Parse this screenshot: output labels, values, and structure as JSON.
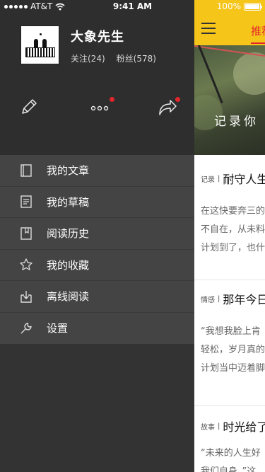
{
  "status_bar": {
    "carrier": "AT&T",
    "time": "9:41 AM",
    "battery": "100%"
  },
  "profile": {
    "username": "大象先生",
    "following": "关注(24)",
    "followers": "粉丝(578)"
  },
  "actions": {
    "edit_icon": "pencil-icon",
    "more_icon": "more-icon",
    "share_icon": "share-icon"
  },
  "menu": [
    {
      "label": "我的文章",
      "icon": "book-icon"
    },
    {
      "label": "我的草稿",
      "icon": "draft-icon"
    },
    {
      "label": "阅读历史",
      "icon": "history-icon"
    },
    {
      "label": "我的收藏",
      "icon": "star-icon"
    },
    {
      "label": "离线阅读",
      "icon": "download-box-icon"
    },
    {
      "label": "设置",
      "icon": "wrench-icon"
    }
  ],
  "main": {
    "tab_label": "推荐",
    "hero_title": "记录你",
    "articles": [
      {
        "category": "记录",
        "title": "耐守人生",
        "body": [
          "在这快要奔三的",
          "不自在，从未料",
          "计划到了，也什"
        ]
      },
      {
        "category": "情感",
        "title": "那年今日",
        "body": [
          "“我想我脸上肯",
          "轻松，岁月真的",
          "计划当中迈着脚"
        ]
      },
      {
        "category": "故事",
        "title": "时光给了",
        "body": [
          "“未来的人生好",
          "我们自身，”这"
        ]
      }
    ]
  },
  "colors": {
    "drawer_bg": "#333333",
    "menu_bg": "#444444",
    "accent_yellow": "#f6c51a",
    "accent_red": "#e3262b"
  }
}
